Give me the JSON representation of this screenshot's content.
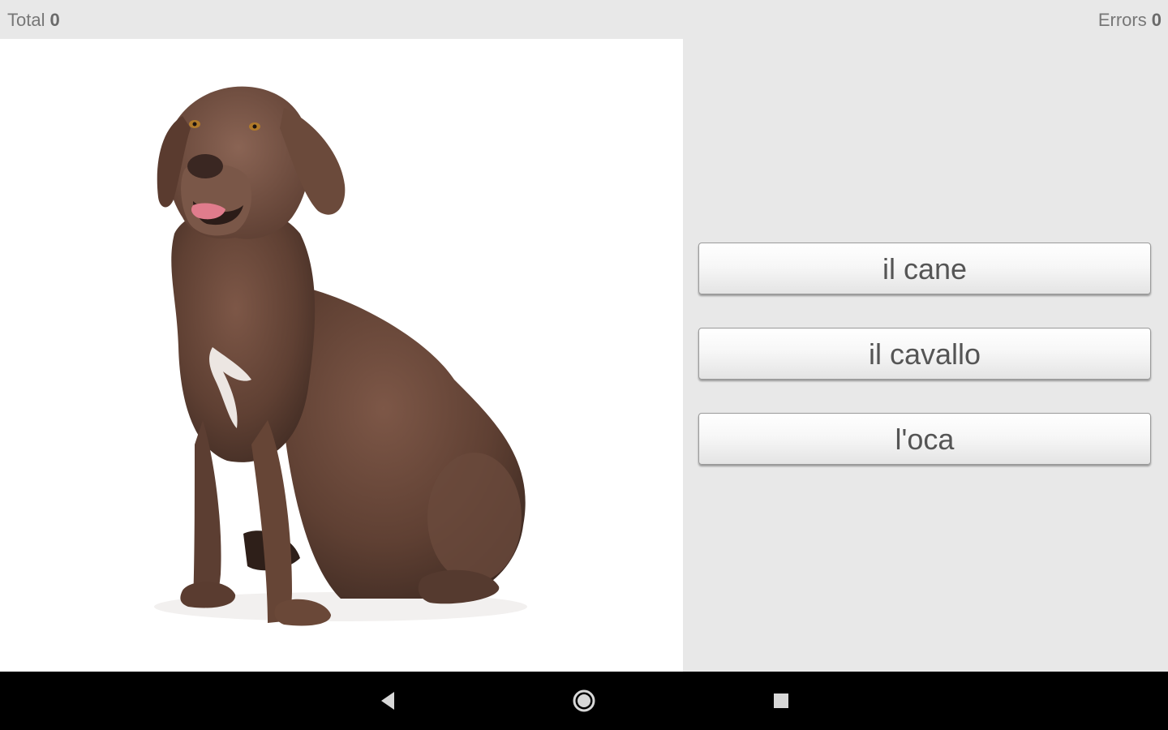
{
  "scores": {
    "total_label": "Total",
    "total_value": "0",
    "errors_label": "Errors",
    "errors_value": "0"
  },
  "picture": {
    "icon": "dog-picture"
  },
  "answers": [
    {
      "label": "il cane"
    },
    {
      "label": "il cavallo"
    },
    {
      "label": "l'oca"
    }
  ],
  "nav": {
    "back_icon": "back-triangle-icon",
    "home_icon": "home-circle-icon",
    "recents_icon": "recents-square-icon"
  },
  "colors": {
    "background": "#e8e8e8",
    "picture_background": "#ffffff",
    "nav_bar": "#000000",
    "dog_fur": "#6b4a3a"
  }
}
